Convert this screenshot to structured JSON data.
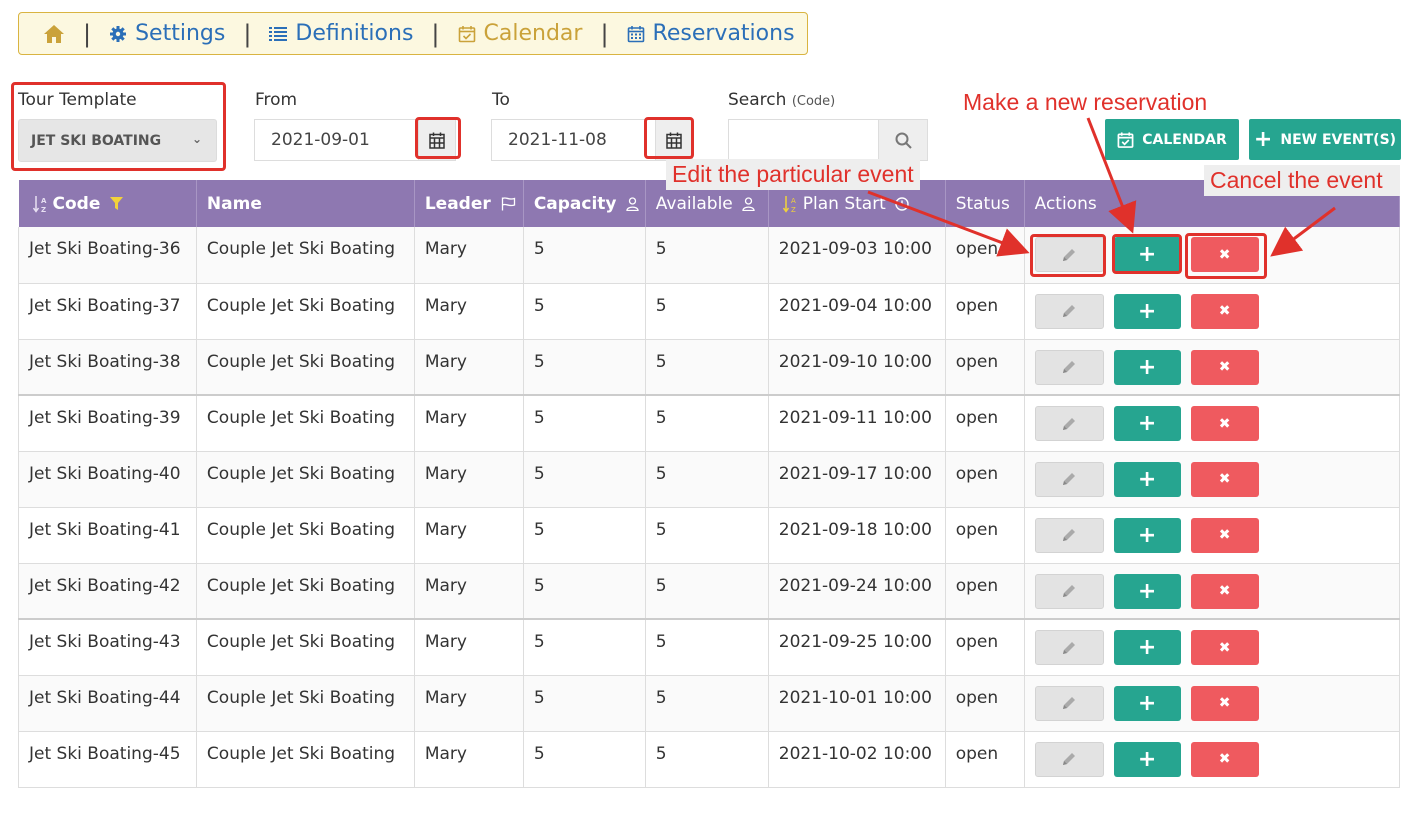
{
  "nav": {
    "items": [
      {
        "label": "Settings",
        "icon": "gear-icon"
      },
      {
        "label": "Definitions",
        "icon": "list-icon"
      },
      {
        "label": "Calendar",
        "icon": "calendar-check-icon"
      },
      {
        "label": "Reservations",
        "icon": "calendar-grid-icon"
      }
    ],
    "separator": "|",
    "active": "Calendar"
  },
  "filters": {
    "tour_template_label": "Tour Template",
    "tour_template_value": "JET SKI BOATING",
    "from_label": "From",
    "from_value": "2021-09-01",
    "to_label": "To",
    "to_value": "2021-11-08",
    "search_label": "Search",
    "search_hint": "(Code)",
    "search_value": ""
  },
  "toolbar": {
    "calendar_label": "CALENDAR",
    "new_events_label": "NEW EVENT(S)"
  },
  "table": {
    "headers": {
      "code": "Code",
      "name": "Name",
      "leader": "Leader",
      "capacity": "Capacity",
      "available": "Available",
      "plan_start": "Plan Start",
      "status": "Status",
      "actions": "Actions"
    },
    "rows": [
      {
        "code": "Jet Ski Boating-36",
        "name": "Couple Jet Ski Boating",
        "leader": "Mary",
        "capacity": "5",
        "available": "5",
        "plan_start": "2021-09-03 10:00",
        "status": "open"
      },
      {
        "code": "Jet Ski Boating-37",
        "name": "Couple Jet Ski Boating",
        "leader": "Mary",
        "capacity": "5",
        "available": "5",
        "plan_start": "2021-09-04 10:00",
        "status": "open"
      },
      {
        "code": "Jet Ski Boating-38",
        "name": "Couple Jet Ski Boating",
        "leader": "Mary",
        "capacity": "5",
        "available": "5",
        "plan_start": "2021-09-10 10:00",
        "status": "open"
      },
      {
        "code": "Jet Ski Boating-39",
        "name": "Couple Jet Ski Boating",
        "leader": "Mary",
        "capacity": "5",
        "available": "5",
        "plan_start": "2021-09-11 10:00",
        "status": "open"
      },
      {
        "code": "Jet Ski Boating-40",
        "name": "Couple Jet Ski Boating",
        "leader": "Mary",
        "capacity": "5",
        "available": "5",
        "plan_start": "2021-09-17 10:00",
        "status": "open"
      },
      {
        "code": "Jet Ski Boating-41",
        "name": "Couple Jet Ski Boating",
        "leader": "Mary",
        "capacity": "5",
        "available": "5",
        "plan_start": "2021-09-18 10:00",
        "status": "open"
      },
      {
        "code": "Jet Ski Boating-42",
        "name": "Couple Jet Ski Boating",
        "leader": "Mary",
        "capacity": "5",
        "available": "5",
        "plan_start": "2021-09-24 10:00",
        "status": "open"
      },
      {
        "code": "Jet Ski Boating-43",
        "name": "Couple Jet Ski Boating",
        "leader": "Mary",
        "capacity": "5",
        "available": "5",
        "plan_start": "2021-09-25 10:00",
        "status": "open"
      },
      {
        "code": "Jet Ski Boating-44",
        "name": "Couple Jet Ski Boating",
        "leader": "Mary",
        "capacity": "5",
        "available": "5",
        "plan_start": "2021-10-01 10:00",
        "status": "open"
      },
      {
        "code": "Jet Ski Boating-45",
        "name": "Couple Jet Ski Boating",
        "leader": "Mary",
        "capacity": "5",
        "available": "5",
        "plan_start": "2021-10-02 10:00",
        "status": "open"
      }
    ],
    "action_icons": {
      "edit": "pencil-icon",
      "add": "plus-icon",
      "cancel": "times-icon"
    }
  },
  "annotations": {
    "make_reservation": "Make a new reservation",
    "edit_event": "Edit the particular event",
    "cancel_event": "Cancel the event"
  },
  "colors": {
    "nav_bg": "#fcf8e0",
    "nav_border": "#d9b441",
    "nav_link": "#2b6fb8",
    "nav_active": "#caa23a",
    "header_bg": "#8e78b1",
    "teal": "#26a590",
    "red": "#ef5a5f",
    "annotation": "#e0312b"
  }
}
